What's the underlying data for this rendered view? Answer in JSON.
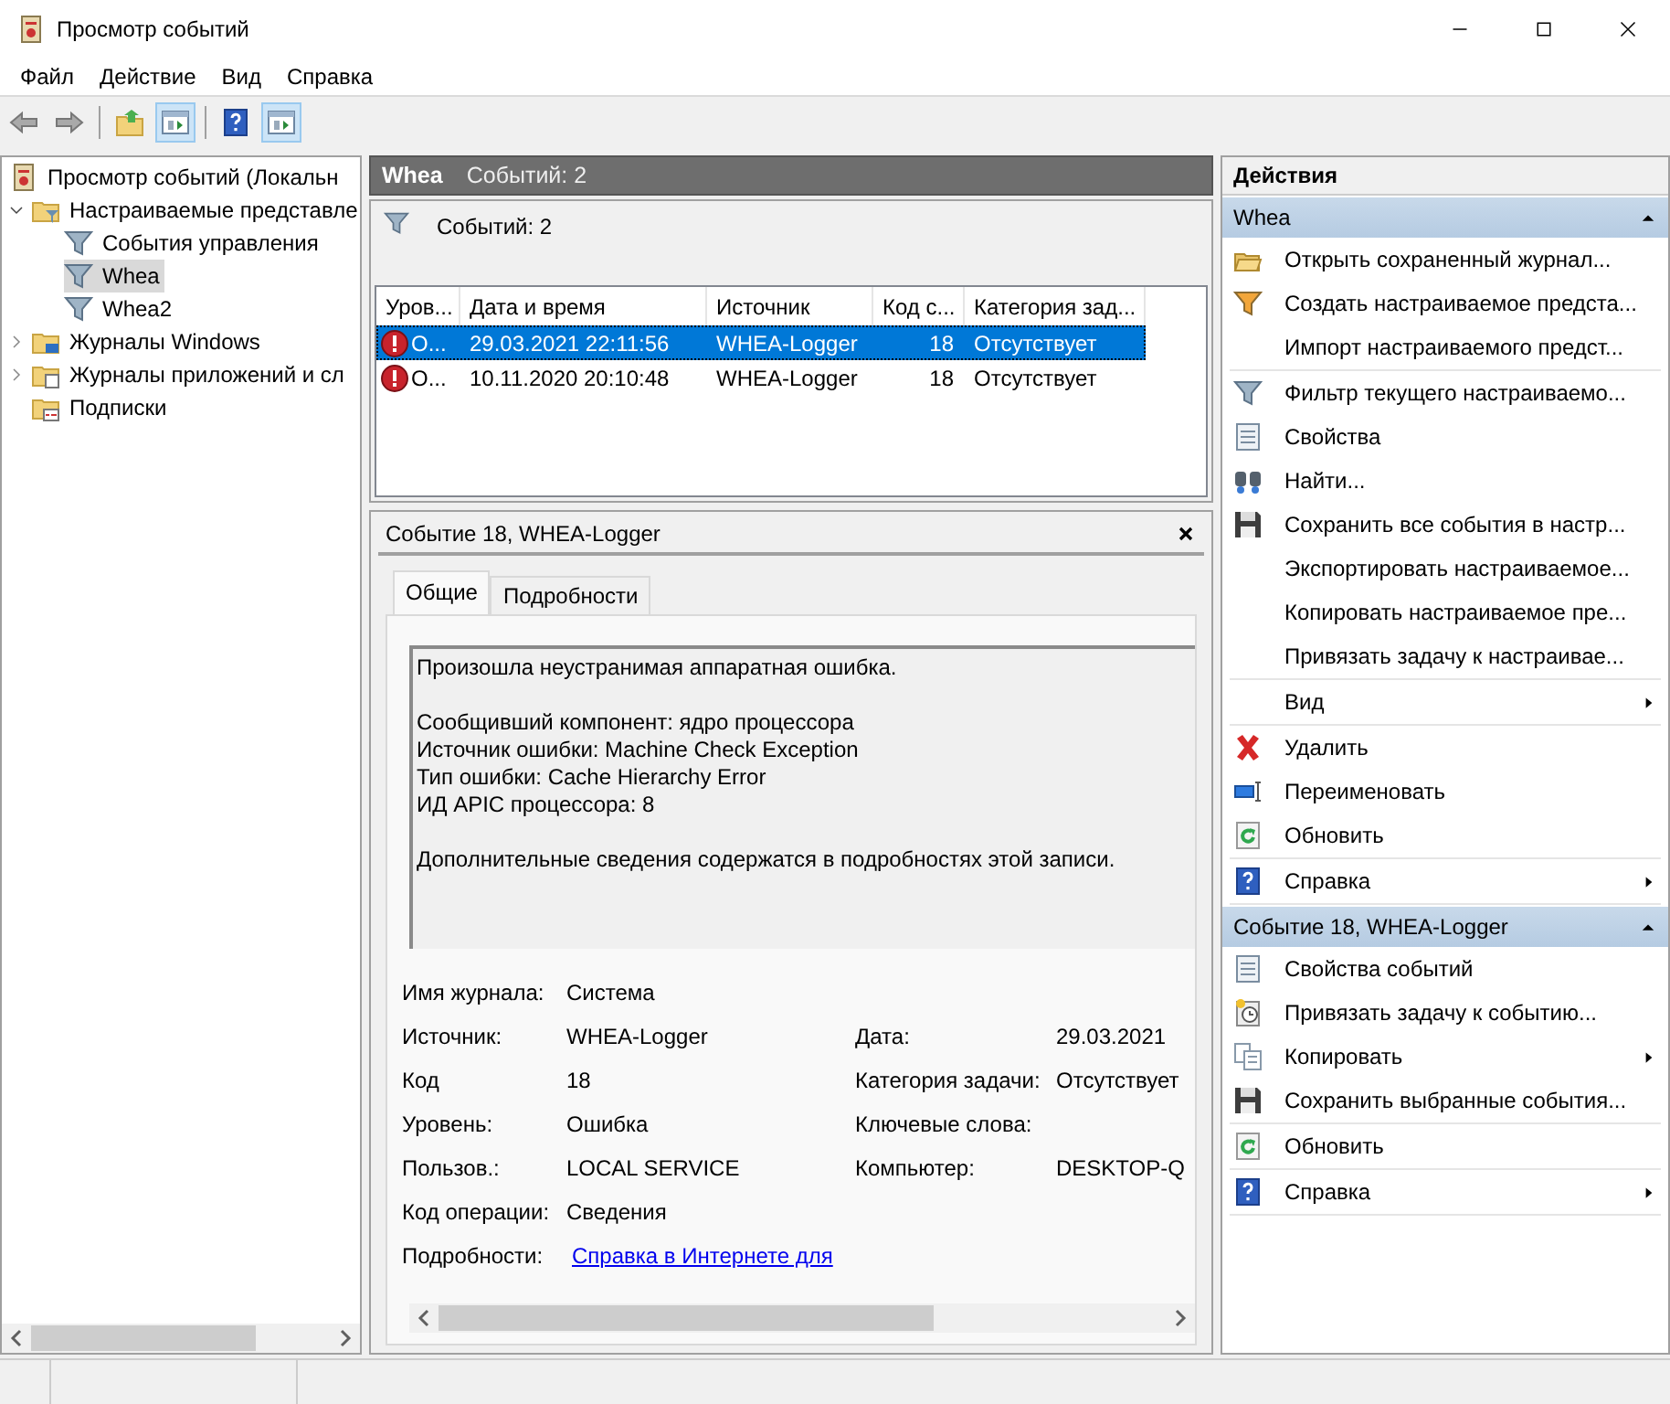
{
  "window": {
    "title": "Просмотр событий"
  },
  "menu": [
    {
      "label": "Файл"
    },
    {
      "label": "Действие"
    },
    {
      "label": "Вид"
    },
    {
      "label": "Справка"
    }
  ],
  "toolbar": [
    {
      "kind": "back",
      "pressed": false
    },
    {
      "kind": "forward",
      "pressed": false
    },
    {
      "kind": "up",
      "pressed": false
    },
    {
      "kind": "pane",
      "pressed": true
    },
    {
      "kind": "help",
      "pressed": false
    },
    {
      "kind": "pane",
      "pressed": true
    }
  ],
  "tree": [
    {
      "label": "Просмотр событий (Локальн",
      "selected": false,
      "children": [
        {
          "label": "Настраиваемые представле",
          "expanded": true,
          "selected": false,
          "children": [
            {
              "label": "События управления",
              "selected": false
            },
            {
              "label": "Whea",
              "selected": true
            },
            {
              "label": "Whea2",
              "selected": false
            }
          ]
        },
        {
          "label": "Журналы Windows",
          "expanded": false,
          "selected": false
        },
        {
          "label": "Журналы приложений и сл",
          "expanded": false,
          "selected": false
        },
        {
          "label": "Подписки",
          "selected": false
        }
      ]
    }
  ],
  "view": {
    "title": "Whea",
    "count": "Событий: 2",
    "filter_text": "Событий: 2",
    "columns": [
      "Уров...",
      "Дата и время",
      "Источник",
      "Код с...",
      "Категория зад..."
    ],
    "rows": [
      {
        "cells": [
          "О...",
          "29.03.2021 22:11:56",
          "WHEA-Logger",
          "18",
          "Отсутствует"
        ],
        "selected": true
      },
      {
        "cells": [
          "О...",
          "10.11.2020 20:10:48",
          "WHEA-Logger",
          "18",
          "Отсутствует"
        ],
        "selected": false
      }
    ]
  },
  "detail": {
    "title": "Событие 18, WHEA-Logger",
    "tabs": [
      {
        "label": "Общие",
        "selected": true
      },
      {
        "label": "Подробности",
        "selected": false
      }
    ],
    "message": [
      [
        "Произошла неустранимая аппаратная ошибка."
      ],
      [
        "Сообщивший компонент: ядро процессора",
        "Источник ошибки: Machine Check Exception",
        "Тип ошибки: Cache Hierarchy Error",
        "ИД APIC процессора: 8"
      ],
      [
        "Дополнительные сведения содержатся в подробностях этой записи."
      ]
    ],
    "fields": [
      {
        "left": {
          "label": "Имя журнала:",
          "value": "Система"
        }
      },
      {
        "left": {
          "label": "Источник:",
          "value": "WHEA-Logger"
        },
        "right": {
          "label": "Дата:",
          "value": "29.03.2021"
        }
      },
      {
        "left": {
          "label": "Код",
          "value": "18"
        },
        "right": {
          "label": "Категория задачи:",
          "value": "Отсутствует"
        }
      },
      {
        "left": {
          "label": "Уровень:",
          "value": "Ошибка"
        },
        "right": {
          "label": "Ключевые слова:"
        }
      },
      {
        "left": {
          "label": "Пользов.:",
          "value": "LOCAL SERVICE"
        },
        "right": {
          "label": "Компьютер:",
          "value": "DESKTOP-Q"
        }
      },
      {
        "left": {
          "label": "Код операции:",
          "value": "Сведения"
        }
      },
      {
        "left": {
          "label": "Подробности:",
          "value": "Справка в Интернете для",
          "kind": "link"
        }
      }
    ]
  },
  "actions": {
    "title": "Действия",
    "sections": [
      {
        "title": "Whea",
        "expanded": true,
        "groups": [
          [
            {
              "label": "Открыть сохраненный журнал...",
              "submenu": false
            },
            {
              "label": "Создать настраиваемое предста...",
              "submenu": false
            },
            {
              "label": "Импорт настраиваемого предст...",
              "submenu": false
            }
          ],
          [
            {
              "label": "Фильтр текущего настраиваемо...",
              "submenu": false
            },
            {
              "label": "Свойства",
              "submenu": false
            },
            {
              "label": "Найти...",
              "submenu": false
            },
            {
              "label": "Сохранить все события в настр...",
              "submenu": false
            },
            {
              "label": "Экспортировать настраиваемое...",
              "submenu": false
            },
            {
              "label": "Копировать настраиваемое пре...",
              "submenu": false
            },
            {
              "label": "Привязать задачу к настраивае...",
              "submenu": false
            }
          ],
          [
            {
              "label": "Вид",
              "submenu": true
            }
          ],
          [
            {
              "label": "Удалить",
              "submenu": false
            },
            {
              "label": "Переименовать",
              "submenu": false
            },
            {
              "label": "Обновить",
              "submenu": false
            }
          ],
          [
            {
              "label": "Справка",
              "submenu": true
            }
          ]
        ]
      },
      {
        "title": "Событие 18, WHEA-Logger",
        "expanded": true,
        "groups": [
          [
            {
              "label": "Свойства событий",
              "submenu": false
            },
            {
              "label": "Привязать задачу к событию...",
              "submenu": false
            },
            {
              "label": "Копировать",
              "submenu": true
            },
            {
              "label": "Сохранить выбранные события...",
              "submenu": false
            }
          ],
          [
            {
              "label": "Обновить",
              "submenu": false
            }
          ],
          [
            {
              "label": "Справка",
              "submenu": true
            }
          ]
        ]
      }
    ]
  }
}
